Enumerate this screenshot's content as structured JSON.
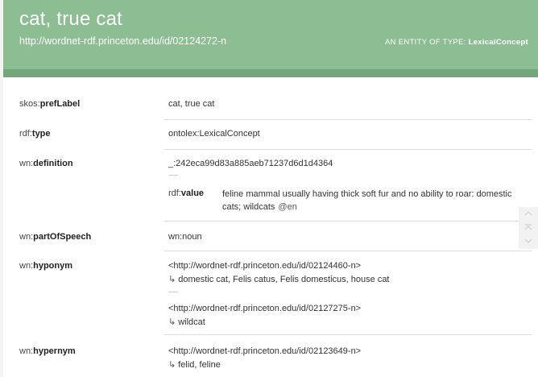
{
  "header": {
    "title": "cat, true cat",
    "uri": "http://wordnet-rdf.princeton.edu/id/02124272-n",
    "entity_type_prefix": "AN ENTITY OF TYPE: ",
    "entity_type": "LexicalConcept"
  },
  "properties": {
    "prefLabel": {
      "ns": "skos:",
      "name": "prefLabel",
      "value": "cat, true cat"
    },
    "type": {
      "ns": "rdf:",
      "name": "type",
      "value": "ontolex:LexicalConcept"
    },
    "definition": {
      "ns": "wn:",
      "name": "definition",
      "value": "_:242eca99d83a885aeb71237d6d1d4364",
      "nested": {
        "ns": "rdf:",
        "name": "value",
        "value": "feline mammal usually having thick soft fur and no ability to roar: domestic cats; wildcats",
        "lang": "@en"
      }
    },
    "partOfSpeech": {
      "ns": "wn:",
      "name": "partOfSpeech",
      "value": "wn:noun"
    },
    "hyponym": {
      "ns": "wn:",
      "name": "hyponym",
      "items": [
        {
          "uri": "<http://wordnet-rdf.princeton.edu/id/02124460-n>",
          "label": "domestic cat, Felis catus, Felis domesticus, house cat"
        },
        {
          "uri": "<http://wordnet-rdf.princeton.edu/id/02127275-n>",
          "label": "wildcat"
        }
      ]
    },
    "hypernym": {
      "ns": "wn:",
      "name": "hypernym",
      "items": [
        {
          "uri": "<http://wordnet-rdf.princeton.edu/id/02123649-n>",
          "label": "felid, feline"
        }
      ]
    }
  },
  "icons": {
    "arrow": "↳",
    "scroll_up": "chevron-up-icon",
    "scroll_top": "skip-top-icon",
    "scroll_down": "chevron-down-icon"
  }
}
